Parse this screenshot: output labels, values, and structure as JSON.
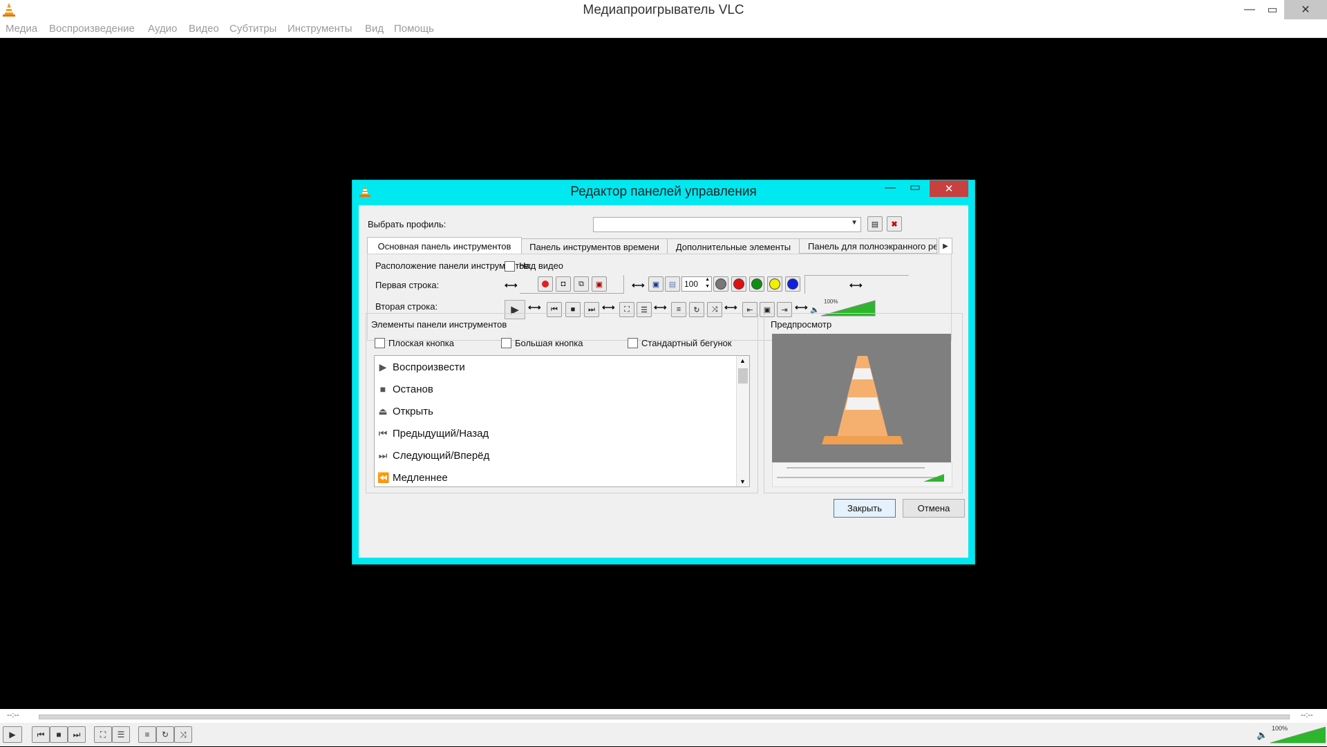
{
  "window": {
    "title": "Медиапроигрыватель VLC",
    "minimize": "—",
    "maximize": "▭",
    "close": "✕"
  },
  "menu": [
    "Медиа",
    "Воспроизведение",
    "Аудио",
    "Видео",
    "Субтитры",
    "Инструменты",
    "Вид",
    "Помощь"
  ],
  "seek": {
    "elapsed": "--:--",
    "remaining": "--:--"
  },
  "volume": {
    "label": "100%",
    "level": 1.0
  },
  "dialog": {
    "title": "Редактор панелей управления",
    "profile_label": "Выбрать профиль:",
    "profile_value": "",
    "tabs": [
      "Основная панель инструментов",
      "Панель инструментов времени",
      "Дополнительные элементы",
      "Панель для полноэкранного ре"
    ],
    "position_label": "Расположение панели инструментов:",
    "above_video_label": "Над видео",
    "row1_label": "Первая строка:",
    "row2_label": "Вторая строка:",
    "spin_value": "100",
    "row2_volume_label": "100%",
    "elements_group_label": "Элементы панели инструментов",
    "flat_button_label": "Плоская кнопка",
    "big_button_label": "Большая кнопка",
    "native_slider_label": "Стандартный бегунок",
    "elements": [
      {
        "icon": "play-icon",
        "label": "Воспроизвести"
      },
      {
        "icon": "stop-icon",
        "label": "Останов"
      },
      {
        "icon": "eject-icon",
        "label": "Открыть"
      },
      {
        "icon": "previous-icon",
        "label": "Предыдущий/Назад"
      },
      {
        "icon": "next-icon",
        "label": "Следующий/Вперёд"
      },
      {
        "icon": "slower-icon",
        "label": "Медленнее"
      }
    ],
    "preview_label": "Предпросмотр",
    "close_button": "Закрыть",
    "cancel_button": "Отмена"
  },
  "colors": {
    "dialog_border": "#00e8f0",
    "close_red": "#c84040",
    "volume_green": "#2db52d"
  }
}
